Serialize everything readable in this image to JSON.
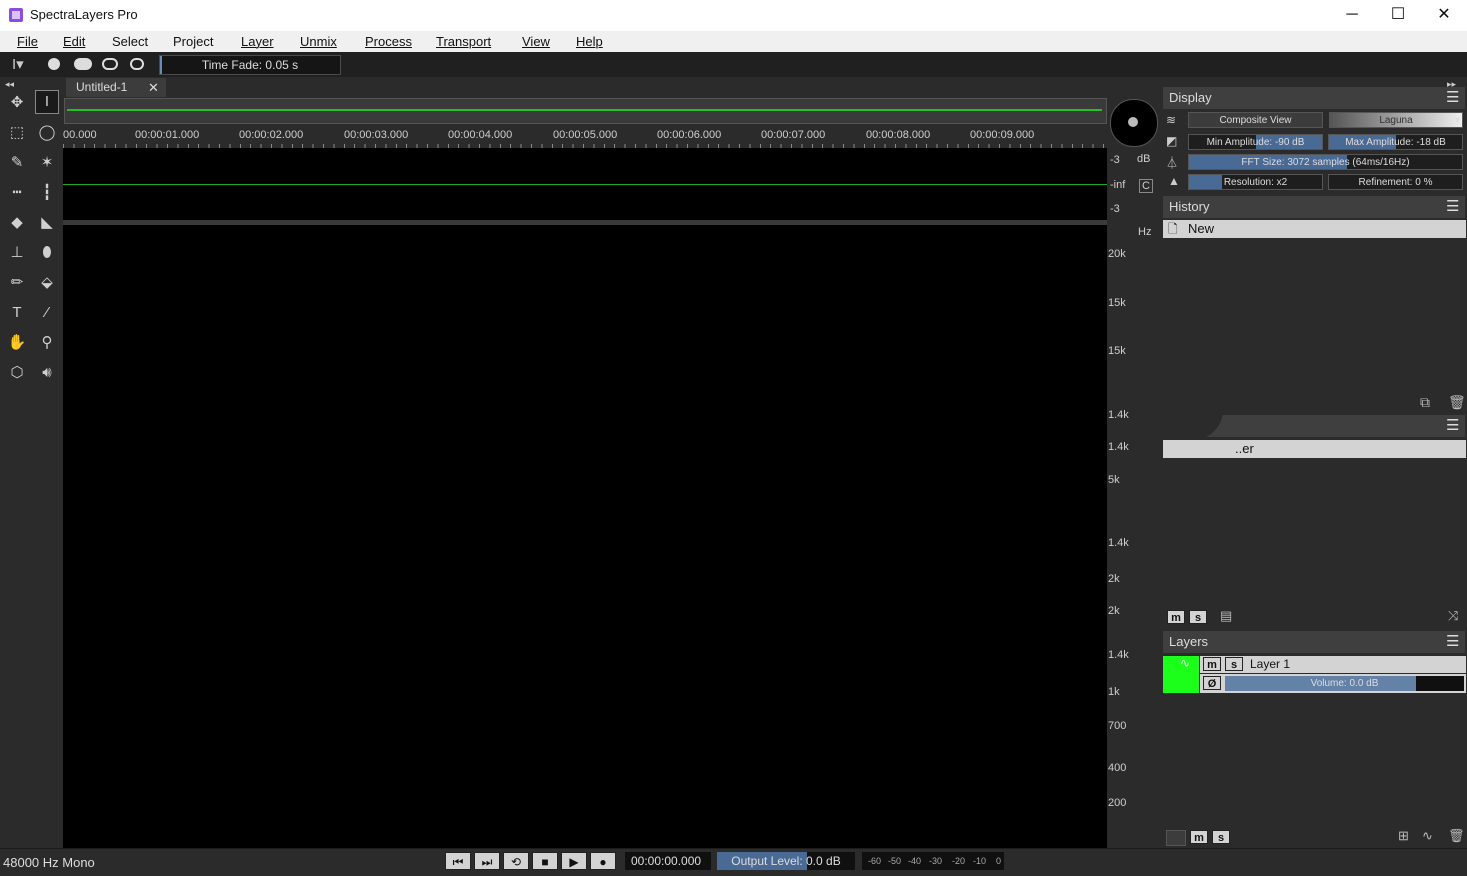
{
  "window": {
    "title": "SpectraLayers Pro",
    "minimize": "─",
    "maximize": "☐",
    "close": "✕"
  },
  "menu": [
    "File",
    "Edit",
    "Select",
    "Project",
    "Layer",
    "Unmix",
    "Process",
    "Transport",
    "View",
    "Help"
  ],
  "toolbar": {
    "time_fade": "Time Fade: 0.05 s"
  },
  "editor": {
    "tab_label": "Untitled-1",
    "tab_close": "✕",
    "ruler_labels": [
      "00.000",
      "00:00:01.000",
      "00:00:02.000",
      "00:00:03.000",
      "00:00:04.000",
      "00:00:05.000",
      "00:00:06.000",
      "00:00:07.000",
      "00:00:08.000",
      "00:00:09.000"
    ],
    "wave_scale": [
      "-3",
      "dB",
      "-inf",
      "C",
      "-3"
    ],
    "freq_unit": "Hz",
    "freq_labels": [
      "20k",
      "15k",
      "15k",
      "1.4k",
      "1.4k",
      "5k",
      "1.4k",
      "2k",
      "2k",
      "1.4k",
      "1k",
      "700",
      "400",
      "200"
    ]
  },
  "display": {
    "title": "Display",
    "composite_view": "Composite View",
    "palette": "Laguna",
    "min_amplitude": "Min Amplitude: -90 dB",
    "max_amplitude": "Max Amplitude: -18 dB",
    "fft_size": "FFT Size: 3072 samples (64ms/16Hz)",
    "resolution": "Resolution: x2",
    "refinement": "Refinement: 0 %"
  },
  "history": {
    "title": "History",
    "items": [
      "New"
    ]
  },
  "middle_panel": {
    "item_label": "..er",
    "m": "m",
    "s": "s"
  },
  "layers": {
    "title": "Layers",
    "layer_name": "Layer 1",
    "m": "m",
    "s": "s",
    "volume": "Volume: 0.0 dB",
    "volume_fraction": 0.8
  },
  "status": {
    "format": "48000 Hz Mono",
    "timecode": "00:00:00.000",
    "output_level": "Output Level: 0.0 dB",
    "meter_ticks": [
      "-60",
      "-50",
      "-40",
      "-30",
      "-20",
      "-10",
      "0"
    ]
  },
  "colors": {
    "waveform": "#1fa81f",
    "layer_color": "#1bff1b",
    "accent": "#4a6a96"
  },
  "icons": [
    "move-icon",
    "time-select-icon",
    "rect-select-icon",
    "lasso-icon",
    "brush-select-icon",
    "magic-wand-icon",
    "eraser-icon",
    "stamp-icon",
    "bandage-icon",
    "brush-icon",
    "fill-icon",
    "text-icon",
    "eyedropper-icon",
    "hand-icon",
    "zoom-icon",
    "cube-icon",
    "speaker-icon"
  ]
}
